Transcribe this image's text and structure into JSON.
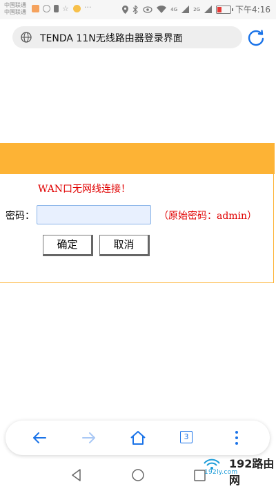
{
  "status_bar": {
    "carrier_1": "中国联通",
    "carrier_2": "中国联通",
    "network_4g": "4G",
    "network_2g": "2G",
    "time": "下午4:16"
  },
  "browser": {
    "address_text": "TENDA 11N无线路由器登录界面",
    "tab_count": "3"
  },
  "page": {
    "wan_message": "WAN口无网线连接！",
    "password_label": "密码：",
    "password_value": "",
    "password_hint": "（原始密码：admin）",
    "ok_button": "确定",
    "cancel_button": "取消"
  },
  "watermark": {
    "brand": "192路由网",
    "url": "192ly.com"
  },
  "colors": {
    "header_bar": "#fdb335",
    "error_text": "#e00000",
    "accent": "#1a73e8"
  },
  "icons": [
    "globe-icon",
    "reload-icon",
    "back-icon",
    "forward-icon",
    "home-icon",
    "tabs-icon",
    "more-icon",
    "nav-back-icon",
    "nav-home-icon",
    "nav-recents-icon"
  ]
}
